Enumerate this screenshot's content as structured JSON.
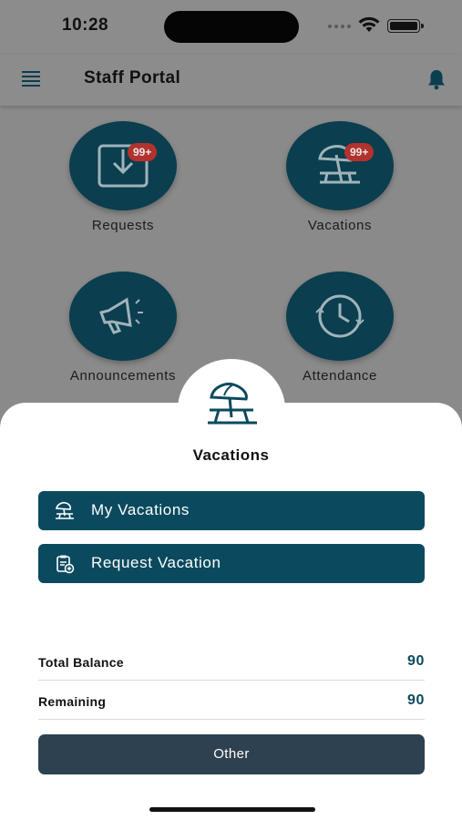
{
  "status_bar": {
    "time": "10:28"
  },
  "header": {
    "title": "Staff Portal"
  },
  "tiles": [
    {
      "label": "Requests",
      "badge": "99+",
      "icon": "download-tray-icon"
    },
    {
      "label": "Vacations",
      "badge": "99+",
      "icon": "beach-umbrella-icon"
    },
    {
      "label": "Announcements",
      "icon": "megaphone-icon"
    },
    {
      "label": "Attendance",
      "icon": "clock-icon"
    }
  ],
  "sheet": {
    "title": "Vacations",
    "icon": "beach-umbrella-icon",
    "buttons": [
      {
        "label": "My Vacations",
        "icon": "beach-umbrella-icon"
      },
      {
        "label": "Request Vacation",
        "icon": "clipboard-add-icon"
      }
    ],
    "rows": [
      {
        "label": "Total Balance",
        "value": "90"
      },
      {
        "label": "Remaining",
        "value": "90"
      }
    ],
    "other_label": "Other"
  },
  "colors": {
    "primary": "#0b4a5e",
    "tile_bg": "#0b3e4e",
    "badge": "#b3322d",
    "other_button": "#2d4151",
    "overlay": "#8a8a8a"
  }
}
